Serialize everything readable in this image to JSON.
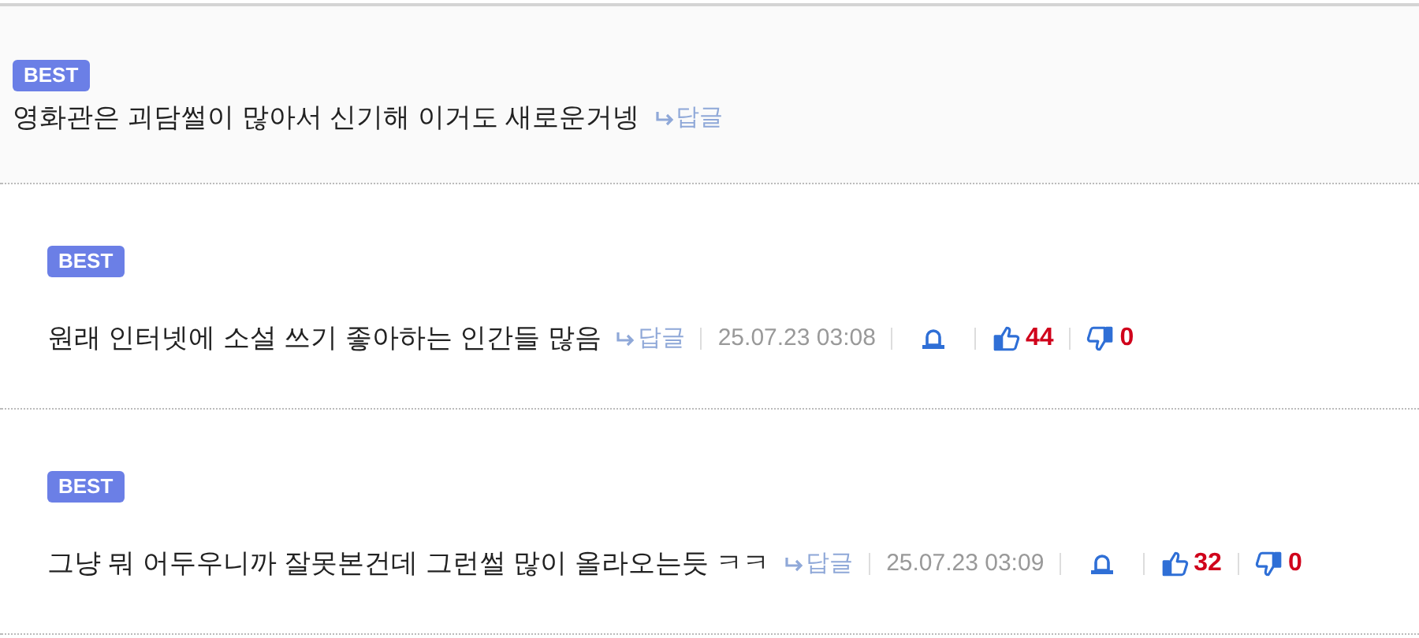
{
  "comments": [
    {
      "badge": "BEST",
      "text": "영화관은 괴담썰이 많아서 신기해 이거도 새로운거넹",
      "reply": "답글",
      "children": [
        {
          "badge": "BEST",
          "text": "원래 인터넷에 소설 쓰기 좋아하는 인간들 많음",
          "reply": "답글",
          "date": "25.07.23 03:08",
          "likes": "44",
          "dislikes": "0"
        },
        {
          "badge": "BEST",
          "text": "그냥 뭐 어두우니까 잘못본건데 그런썰 많이 올라오는듯 ㅋㅋ",
          "reply": "답글",
          "date": "25.07.23 03:09",
          "likes": "32",
          "dislikes": "0"
        }
      ]
    }
  ]
}
